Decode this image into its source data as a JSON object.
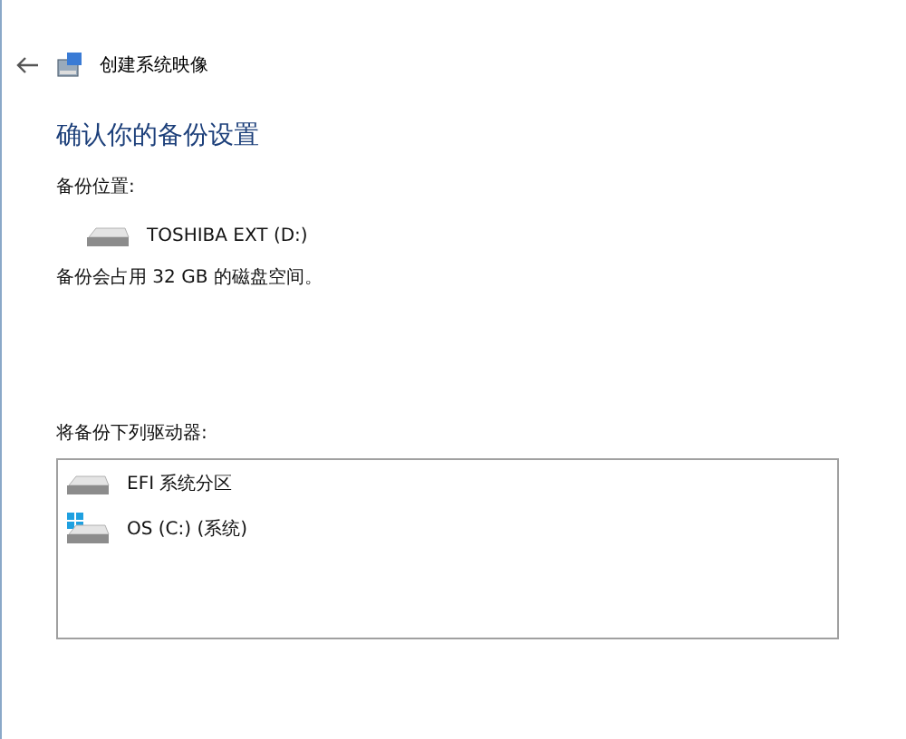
{
  "window": {
    "title": "创建系统映像"
  },
  "heading": "确认你的备份设置",
  "location_label": "备份位置:",
  "location_drive": {
    "kind": "drive",
    "name": "TOSHIBA EXT (D:)"
  },
  "space_note": "备份会占用 32 GB 的磁盘空间。",
  "drives_label": "将备份下列驱动器:",
  "drives": [
    {
      "kind": "drive",
      "name": "EFI 系统分区"
    },
    {
      "kind": "windows-drive",
      "name": "OS (C:) (系统)"
    }
  ]
}
